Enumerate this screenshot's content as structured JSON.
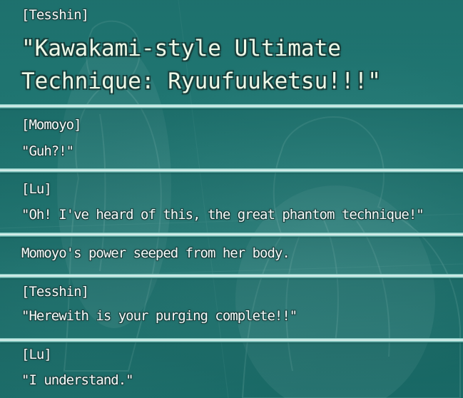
{
  "backlog": {
    "entries": [
      {
        "speaker": "[Tesshin]",
        "lines": [
          "\"Kawakami-style Ultimate",
          "Technique: Ryuufuuketsu!!!\""
        ]
      },
      {
        "speaker": "[Momoyo]",
        "lines": [
          "\"Guh?!\""
        ]
      },
      {
        "speaker": "[Lu]",
        "lines": [
          "\"Oh! I've heard of this, the great phantom technique!\""
        ]
      },
      {
        "speaker": "",
        "lines": [
          "Momoyo's power seeped from her body."
        ]
      },
      {
        "speaker": "[Tesshin]",
        "lines": [
          "\"Herewith is your purging complete!!\""
        ]
      },
      {
        "speaker": "[Lu]",
        "lines": [
          "\"I understand.\""
        ]
      }
    ]
  },
  "colors": {
    "background": "#1c6f6c",
    "separator": "#cdebe6",
    "text": "#f4fbfa",
    "outline": "#1a3f3d"
  }
}
